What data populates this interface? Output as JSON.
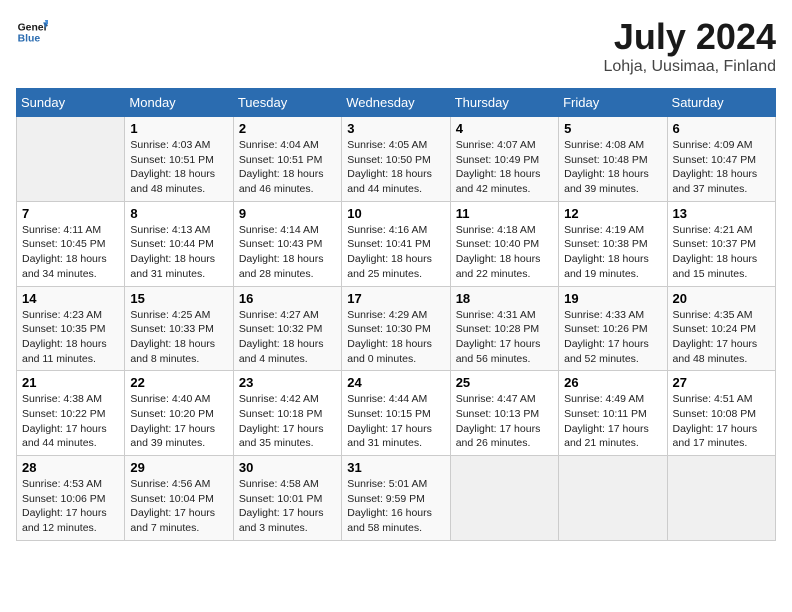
{
  "header": {
    "logo_line1": "General",
    "logo_line2": "Blue",
    "title": "July 2024",
    "subtitle": "Lohja, Uusimaa, Finland"
  },
  "weekdays": [
    "Sunday",
    "Monday",
    "Tuesday",
    "Wednesday",
    "Thursday",
    "Friday",
    "Saturday"
  ],
  "weeks": [
    [
      {
        "day": "",
        "info": ""
      },
      {
        "day": "1",
        "info": "Sunrise: 4:03 AM\nSunset: 10:51 PM\nDaylight: 18 hours\nand 48 minutes."
      },
      {
        "day": "2",
        "info": "Sunrise: 4:04 AM\nSunset: 10:51 PM\nDaylight: 18 hours\nand 46 minutes."
      },
      {
        "day": "3",
        "info": "Sunrise: 4:05 AM\nSunset: 10:50 PM\nDaylight: 18 hours\nand 44 minutes."
      },
      {
        "day": "4",
        "info": "Sunrise: 4:07 AM\nSunset: 10:49 PM\nDaylight: 18 hours\nand 42 minutes."
      },
      {
        "day": "5",
        "info": "Sunrise: 4:08 AM\nSunset: 10:48 PM\nDaylight: 18 hours\nand 39 minutes."
      },
      {
        "day": "6",
        "info": "Sunrise: 4:09 AM\nSunset: 10:47 PM\nDaylight: 18 hours\nand 37 minutes."
      }
    ],
    [
      {
        "day": "7",
        "info": "Sunrise: 4:11 AM\nSunset: 10:45 PM\nDaylight: 18 hours\nand 34 minutes."
      },
      {
        "day": "8",
        "info": "Sunrise: 4:13 AM\nSunset: 10:44 PM\nDaylight: 18 hours\nand 31 minutes."
      },
      {
        "day": "9",
        "info": "Sunrise: 4:14 AM\nSunset: 10:43 PM\nDaylight: 18 hours\nand 28 minutes."
      },
      {
        "day": "10",
        "info": "Sunrise: 4:16 AM\nSunset: 10:41 PM\nDaylight: 18 hours\nand 25 minutes."
      },
      {
        "day": "11",
        "info": "Sunrise: 4:18 AM\nSunset: 10:40 PM\nDaylight: 18 hours\nand 22 minutes."
      },
      {
        "day": "12",
        "info": "Sunrise: 4:19 AM\nSunset: 10:38 PM\nDaylight: 18 hours\nand 19 minutes."
      },
      {
        "day": "13",
        "info": "Sunrise: 4:21 AM\nSunset: 10:37 PM\nDaylight: 18 hours\nand 15 minutes."
      }
    ],
    [
      {
        "day": "14",
        "info": "Sunrise: 4:23 AM\nSunset: 10:35 PM\nDaylight: 18 hours\nand 11 minutes."
      },
      {
        "day": "15",
        "info": "Sunrise: 4:25 AM\nSunset: 10:33 PM\nDaylight: 18 hours\nand 8 minutes."
      },
      {
        "day": "16",
        "info": "Sunrise: 4:27 AM\nSunset: 10:32 PM\nDaylight: 18 hours\nand 4 minutes."
      },
      {
        "day": "17",
        "info": "Sunrise: 4:29 AM\nSunset: 10:30 PM\nDaylight: 18 hours\nand 0 minutes."
      },
      {
        "day": "18",
        "info": "Sunrise: 4:31 AM\nSunset: 10:28 PM\nDaylight: 17 hours\nand 56 minutes."
      },
      {
        "day": "19",
        "info": "Sunrise: 4:33 AM\nSunset: 10:26 PM\nDaylight: 17 hours\nand 52 minutes."
      },
      {
        "day": "20",
        "info": "Sunrise: 4:35 AM\nSunset: 10:24 PM\nDaylight: 17 hours\nand 48 minutes."
      }
    ],
    [
      {
        "day": "21",
        "info": "Sunrise: 4:38 AM\nSunset: 10:22 PM\nDaylight: 17 hours\nand 44 minutes."
      },
      {
        "day": "22",
        "info": "Sunrise: 4:40 AM\nSunset: 10:20 PM\nDaylight: 17 hours\nand 39 minutes."
      },
      {
        "day": "23",
        "info": "Sunrise: 4:42 AM\nSunset: 10:18 PM\nDaylight: 17 hours\nand 35 minutes."
      },
      {
        "day": "24",
        "info": "Sunrise: 4:44 AM\nSunset: 10:15 PM\nDaylight: 17 hours\nand 31 minutes."
      },
      {
        "day": "25",
        "info": "Sunrise: 4:47 AM\nSunset: 10:13 PM\nDaylight: 17 hours\nand 26 minutes."
      },
      {
        "day": "26",
        "info": "Sunrise: 4:49 AM\nSunset: 10:11 PM\nDaylight: 17 hours\nand 21 minutes."
      },
      {
        "day": "27",
        "info": "Sunrise: 4:51 AM\nSunset: 10:08 PM\nDaylight: 17 hours\nand 17 minutes."
      }
    ],
    [
      {
        "day": "28",
        "info": "Sunrise: 4:53 AM\nSunset: 10:06 PM\nDaylight: 17 hours\nand 12 minutes."
      },
      {
        "day": "29",
        "info": "Sunrise: 4:56 AM\nSunset: 10:04 PM\nDaylight: 17 hours\nand 7 minutes."
      },
      {
        "day": "30",
        "info": "Sunrise: 4:58 AM\nSunset: 10:01 PM\nDaylight: 17 hours\nand 3 minutes."
      },
      {
        "day": "31",
        "info": "Sunrise: 5:01 AM\nSunset: 9:59 PM\nDaylight: 16 hours\nand 58 minutes."
      },
      {
        "day": "",
        "info": ""
      },
      {
        "day": "",
        "info": ""
      },
      {
        "day": "",
        "info": ""
      }
    ]
  ]
}
